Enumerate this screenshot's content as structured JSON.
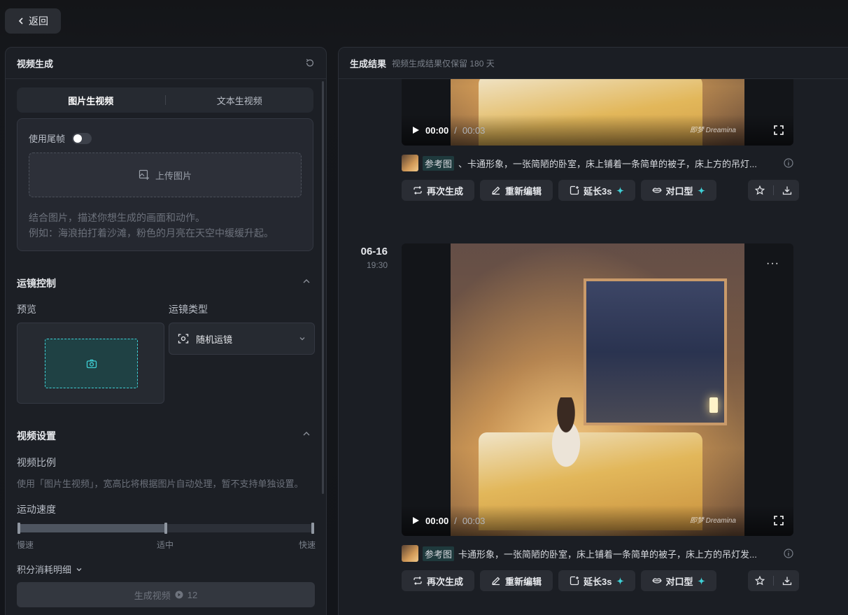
{
  "back_button": {
    "label": "返回"
  },
  "left_panel": {
    "title": "视频生成",
    "tabs": [
      {
        "label": "图片生视频",
        "active": true
      },
      {
        "label": "文本生视频",
        "active": false
      }
    ],
    "tail_frame": {
      "label": "使用尾帧",
      "enabled": false
    },
    "upload": {
      "label": "上传图片"
    },
    "hint_lines": [
      "结合图片，描述你想生成的画面和动作。",
      "例如：海浪拍打着沙滩，粉色的月亮在天空中缓缓升起。"
    ],
    "camera_section": {
      "title": "运镜控制",
      "preview_label": "预览",
      "type_label": "运镜类型",
      "type_value": "随机运镜"
    },
    "video_settings": {
      "title": "视频设置",
      "ratio_label": "视频比例",
      "ratio_hint": "使用「图片生视频」，宽高比将根据图片自动处理，暂不支持单独设置。",
      "speed_label": "运动速度",
      "speed_levels": [
        "慢速",
        "适中",
        "快速"
      ],
      "speed_value": 0.5
    },
    "credits_label": "积分消耗明细",
    "generate": {
      "label": "生成视频",
      "cost": "12"
    }
  },
  "right_panel": {
    "title": "生成结果",
    "subtitle": "视频生成结果仅保留 180 天",
    "results": [
      {
        "date": "",
        "time": "",
        "current_time": "00:00",
        "duration": "00:03",
        "watermark": "即梦 Dreamina",
        "ref_tag": "参考图",
        "prompt": "、卡通形象，一张简陋的卧室，床上铺着一条简单的被子，床上方的吊灯..."
      },
      {
        "date": "06-16",
        "time": "19:30",
        "current_time": "00:00",
        "duration": "00:03",
        "watermark": "即梦 Dreamina",
        "ref_tag": "参考图",
        "prompt": "卡通形象，一张简陋的卧室，床上铺着一条简单的被子，床上方的吊灯发..."
      }
    ],
    "actions": {
      "regenerate": "再次生成",
      "reedit": "重新编辑",
      "extend": "延长3s",
      "lipsync": "对口型"
    },
    "accent_color": "#3fd0d6"
  }
}
